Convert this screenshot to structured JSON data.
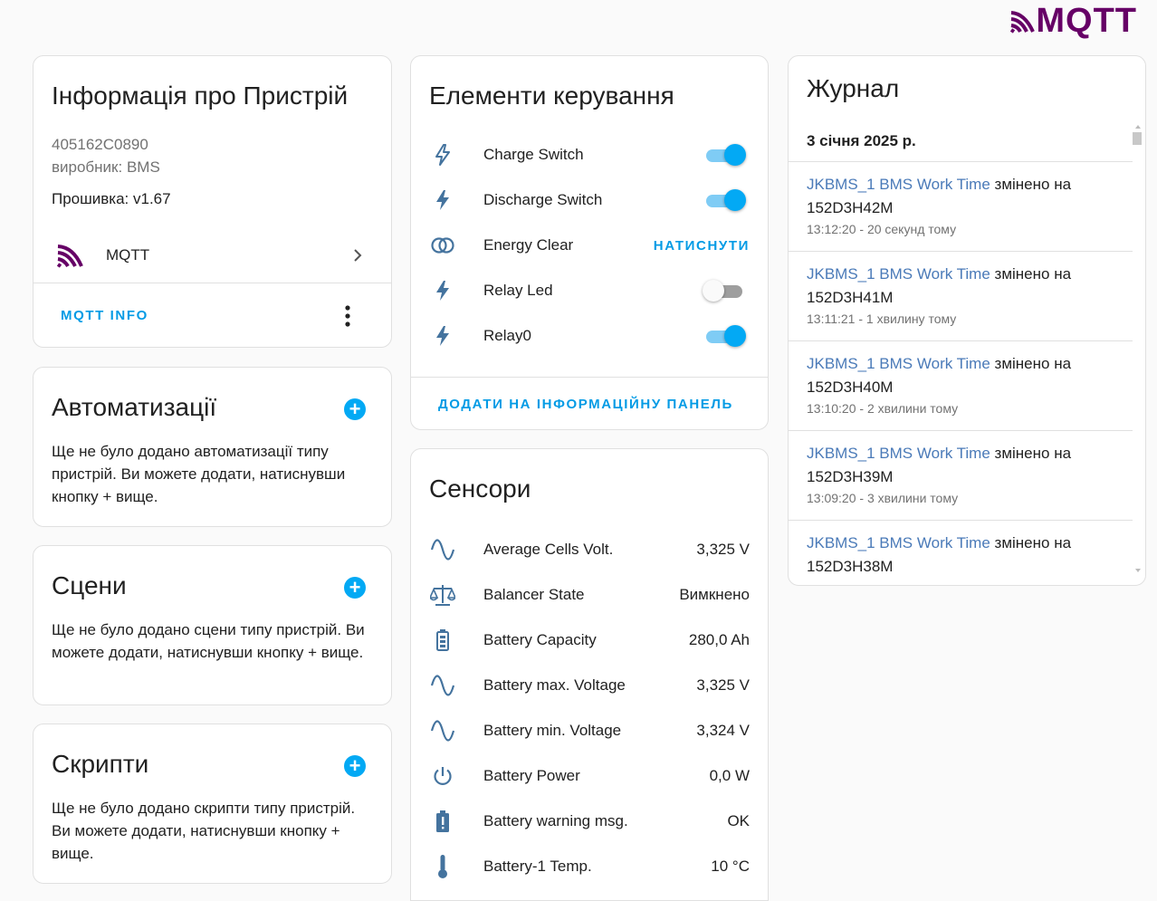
{
  "brand": {
    "logo_text": "MQTT"
  },
  "device_info": {
    "title": "Інформація про Пристрій",
    "serial": "405162C0890",
    "manufacturer": "виробник: BMS",
    "firmware": "Прошивка: v1.67",
    "integration_label": "MQTT",
    "info_button": "MQTT INFO"
  },
  "automations": {
    "title": "Автоматизації",
    "text": "Ще не було додано автоматизації типу пристрій. Ви можете додати, натиснувши кнопку + вище."
  },
  "scenes": {
    "title": "Сцени",
    "text": "Ще не було додано сцени типу пристрій. Ви можете додати, натиснувши кнопку + вище."
  },
  "scripts": {
    "title": "Скрипти",
    "text": "Ще не було додано скрипти типу пристрій. Ви можете додати, натиснувши кнопку + вище."
  },
  "controls": {
    "title": "Елементи керування",
    "items": [
      {
        "icon": "flash-outline-icon",
        "name": "Charge Switch",
        "state": "on"
      },
      {
        "icon": "flash-icon",
        "name": "Discharge Switch",
        "state": "on"
      },
      {
        "icon": "circles-icon",
        "name": "Energy Clear",
        "action": "НАТИСНУТИ"
      },
      {
        "icon": "flash-icon",
        "name": "Relay Led",
        "state": "off"
      },
      {
        "icon": "flash-icon",
        "name": "Relay0",
        "state": "on"
      }
    ],
    "add_button": "ДОДАТИ НА ІНФОРМАЦІЙНУ ПАНЕЛЬ"
  },
  "sensors": {
    "title": "Сенсори",
    "items": [
      {
        "icon": "sine-wave-icon",
        "name": "Average Cells Volt.",
        "value": "3,325 V"
      },
      {
        "icon": "scale-balance-icon",
        "name": "Balancer State",
        "value": "Вимкнено"
      },
      {
        "icon": "battery-icon",
        "name": "Battery Capacity",
        "value": "280,0 Ah"
      },
      {
        "icon": "sine-wave-icon",
        "name": "Battery max. Voltage",
        "value": "3,325 V"
      },
      {
        "icon": "sine-wave-icon",
        "name": "Battery min. Voltage",
        "value": "3,324 V"
      },
      {
        "icon": "power-icon",
        "name": "Battery Power",
        "value": "0,0 W"
      },
      {
        "icon": "battery-alert-icon",
        "name": "Battery warning msg.",
        "value": "OK"
      },
      {
        "icon": "thermometer-icon",
        "name": "Battery-1 Temp.",
        "value": "10 °C"
      }
    ]
  },
  "logbook": {
    "title": "Журнал",
    "date": "3 січня 2025 р.",
    "entries": [
      {
        "entity": "JKBMS_1 BMS Work Time",
        "changed": "змінено на",
        "value": "152D3H42M",
        "time": "13:12:20 - 20 секунд тому"
      },
      {
        "entity": "JKBMS_1 BMS Work Time",
        "changed": "змінено на",
        "value": "152D3H41M",
        "time": "13:11:21 - 1 хвилину тому"
      },
      {
        "entity": "JKBMS_1 BMS Work Time",
        "changed": "змінено на",
        "value": "152D3H40M",
        "time": "13:10:20 - 2 хвилини тому"
      },
      {
        "entity": "JKBMS_1 BMS Work Time",
        "changed": "змінено на",
        "value": "152D3H39M",
        "time": "13:09:20 - 3 хвилини тому"
      },
      {
        "entity": "JKBMS_1 BMS Work Time",
        "changed": "змінено на",
        "value": "152D3H38M",
        "time": ""
      }
    ]
  },
  "colors": {
    "accent": "#03a9f4",
    "mqtt_purple": "#660066",
    "icon_blue": "#44739e",
    "link_blue": "#4a7ab8"
  }
}
